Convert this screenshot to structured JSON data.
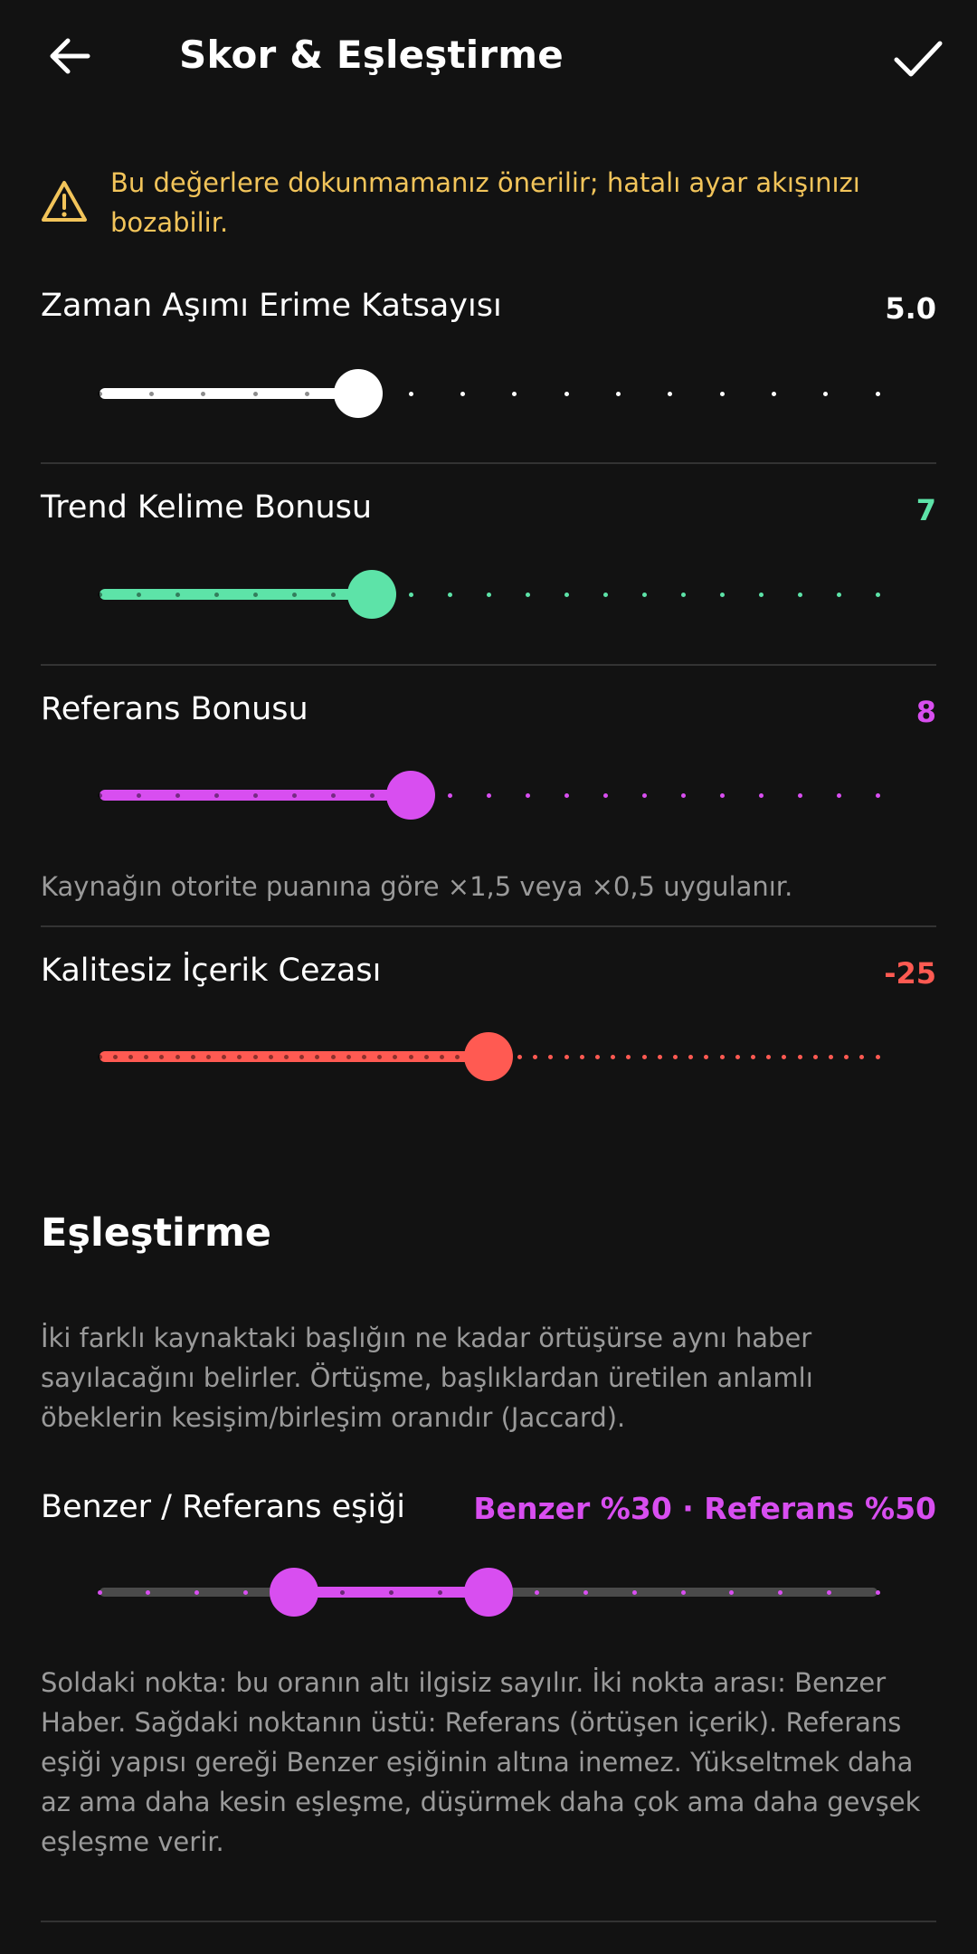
{
  "header": {
    "title": "Skor & Eşleştirme",
    "back_icon": "arrow-left-icon",
    "confirm_icon": "check-icon"
  },
  "warning": {
    "icon": "warning-triangle-icon",
    "text": "Bu değerlere dokunmamanız önerilir; hatalı ayar akışınızı bozabilir.",
    "color": "#f2c45a"
  },
  "sliders": [
    {
      "key": "timeout",
      "label": "Zaman Aşımı Erime Katsayısı",
      "value_text": "5.0",
      "color": "#ffffff",
      "level": 0.333,
      "steps": 15
    },
    {
      "key": "trend",
      "label": "Trend Kelime Bonusu",
      "value_text": "7",
      "color": "#5de3a8",
      "level": 0.35,
      "steps": 20
    },
    {
      "key": "ref",
      "label": "Referans Bonusu",
      "value_text": "8",
      "color": "#d84ef0",
      "level": 0.4,
      "steps": 20
    },
    {
      "key": "quality",
      "label": "Kalitesiz İçerik Cezası",
      "value_text": "-25",
      "color": "#ff5a52",
      "level": 0.5,
      "steps": 50
    }
  ],
  "ref_note": "Kaynağın otorite puanına göre ×1,5 veya ×0,5 uygulanır.",
  "matching": {
    "heading": "Eşleştirme",
    "description": "İki farklı kaynaktaki başlığın ne kadar örtüşürse aynı haber sayılacağını belirler. Örtüşme, başlıklardan üretilen anlamlı öbeklerin kesişim/birleşim oranıdır (Jaccard).",
    "range_label": "Benzer / Referans eşiği",
    "range_value": "Benzer %30 · Referans %50",
    "color": "#d84ef0",
    "low": 0.25,
    "high": 0.5,
    "steps": 16,
    "help": "Soldaki nokta: bu oranın altı ilgisiz sayılır. İki nokta arası: Benzer Haber. Sağdaki noktanın üstü: Referans (örtüşen içerik). Referans eşiği yapısı gereği Benzer eşiğinin altına inemez. Yükseltmek daha az ama daha kesin eşleşme, düşürmek daha çok ama daha gevşek eşleşme verir."
  }
}
